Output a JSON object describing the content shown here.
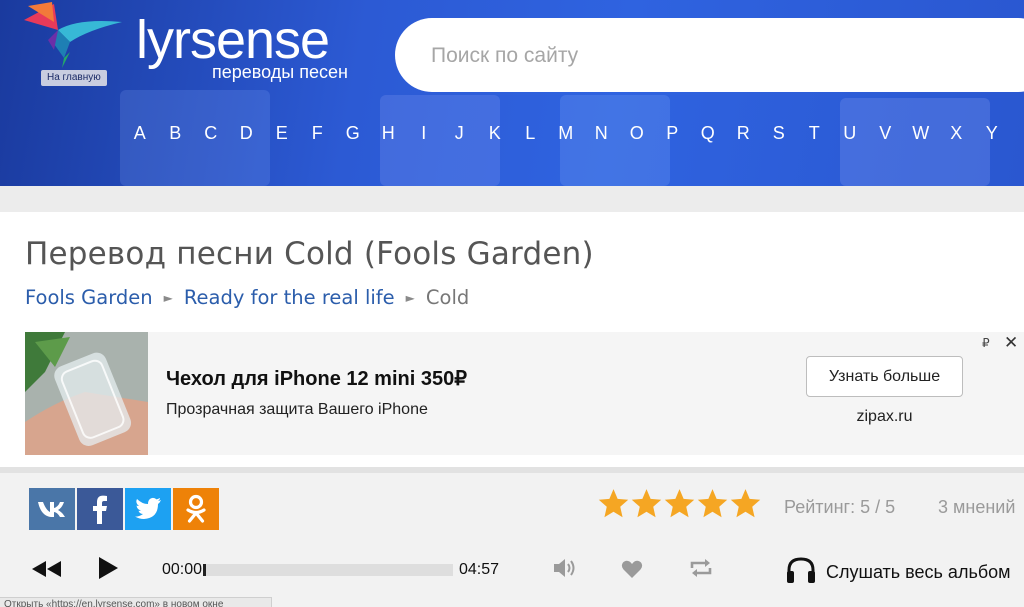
{
  "header": {
    "brand": "lyrsense",
    "brand_sub": "переводы песен",
    "home_badge": "На главную",
    "search_placeholder": "Поиск по сайту",
    "letters": [
      "A",
      "B",
      "C",
      "D",
      "E",
      "F",
      "G",
      "H",
      "I",
      "J",
      "K",
      "L",
      "M",
      "N",
      "O",
      "P",
      "Q",
      "R",
      "S",
      "T",
      "U",
      "V",
      "W",
      "X",
      "Y"
    ]
  },
  "page": {
    "title": "Перевод песни Cold (Fools Garden)",
    "breadcrumbs": [
      {
        "label": "Fools Garden"
      },
      {
        "label": "Ready for the real life"
      },
      {
        "label": "Cold"
      }
    ],
    "breadcrumb_separator": "►"
  },
  "ad": {
    "title": "Чехол для iPhone 12 mini 350₽",
    "description": "Прозрачная защита Вашего iPhone",
    "button": "Узнать больше",
    "domain": "zipax.ru",
    "currency_mark": "₽",
    "close": "✕"
  },
  "social": {
    "buttons": [
      {
        "name": "vk",
        "label": "ВК",
        "color": "#4a76a8"
      },
      {
        "name": "facebook",
        "label": "f",
        "color": "#3b5998"
      },
      {
        "name": "twitter",
        "label": "t",
        "color": "#1da1f2"
      },
      {
        "name": "odnoklassniki",
        "label": "ok",
        "color": "#ee8208"
      }
    ]
  },
  "rating": {
    "stars_filled": 5,
    "stars_total": 5,
    "text": "Рейтинг: 5 / 5",
    "opinions": "3 мнений",
    "star_color": "#f5a623"
  },
  "player": {
    "current_time": "00:00",
    "duration": "04:57",
    "progress_fraction": 0.01,
    "album_label": "Слушать весь альбом"
  },
  "status_bar": {
    "text": "Открыть «https://en.lyrsense.com» в новом окне"
  },
  "colors": {
    "header_blue": "#2c5ad4",
    "link_blue": "#2b5dab"
  }
}
